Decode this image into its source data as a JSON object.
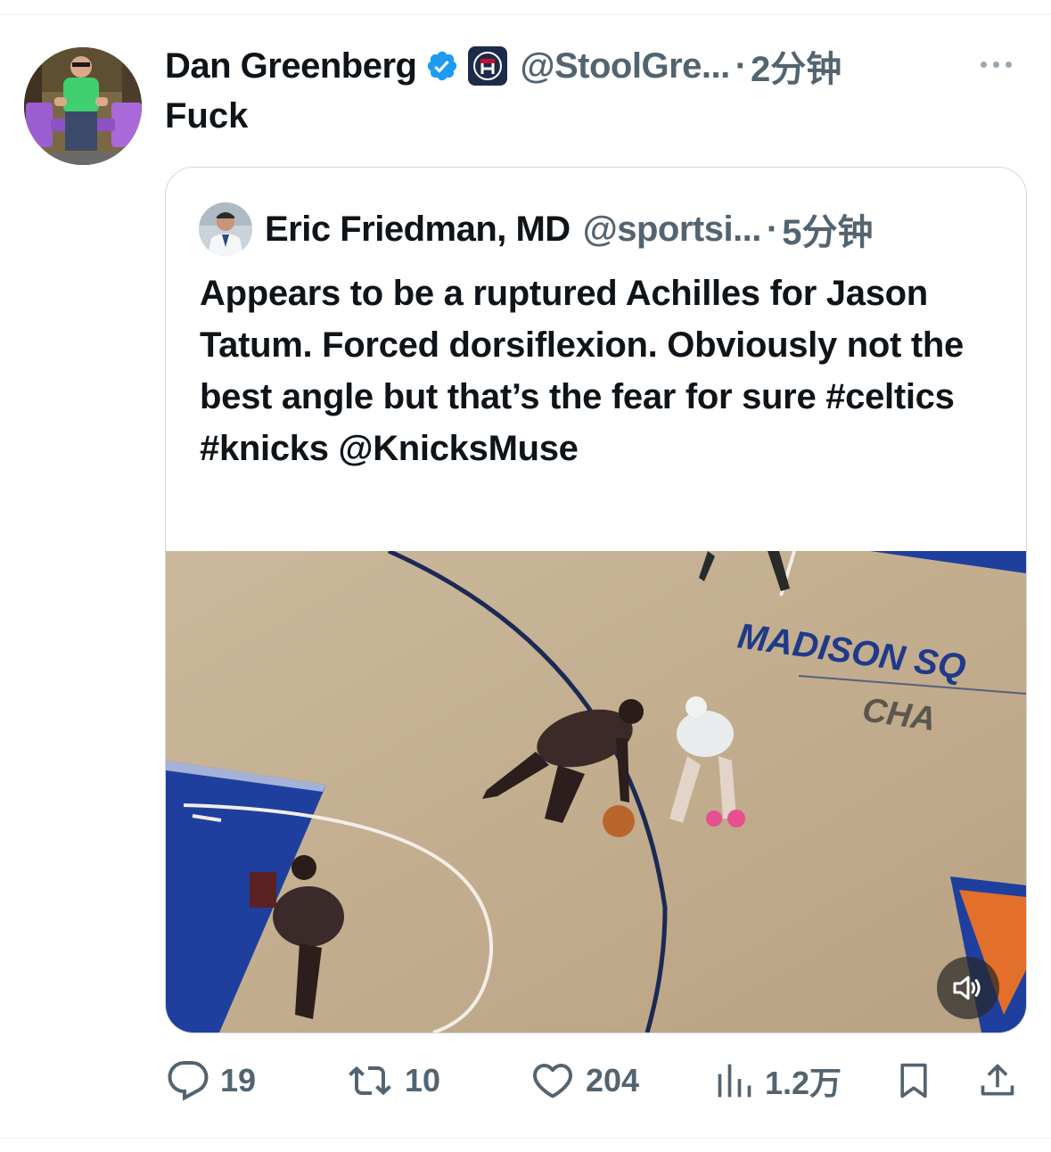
{
  "tweet": {
    "display_name": "Dan Greenberg",
    "handle": "@StoolGre...",
    "separator": "·",
    "time": "2分钟",
    "text": "Fuck",
    "verified_icon": "verified-badge-icon",
    "affiliation_icon": "barstool-logo-icon"
  },
  "quote": {
    "display_name": "Eric Friedman, MD",
    "handle": "@sportsi...",
    "separator": "·",
    "time": "5分钟",
    "text": "Appears to be a ruptured Achilles for Jason Tatum. Forced dorsiflexion. Obviously not the best angle but that’s the fear for sure #celtics #knicks @KnicksMuse",
    "media": {
      "court_text_line1": "MADISON SQ",
      "court_text_line2": "CHA",
      "mute_icon": "speaker-muted-icon"
    }
  },
  "actions": {
    "replies": "19",
    "retweets": "10",
    "likes": "204",
    "views": "1.2万"
  },
  "colors": {
    "text_primary": "#0f1419",
    "text_secondary": "#536471",
    "verified_blue": "#1d9bf0",
    "border": "#cfd9de"
  }
}
